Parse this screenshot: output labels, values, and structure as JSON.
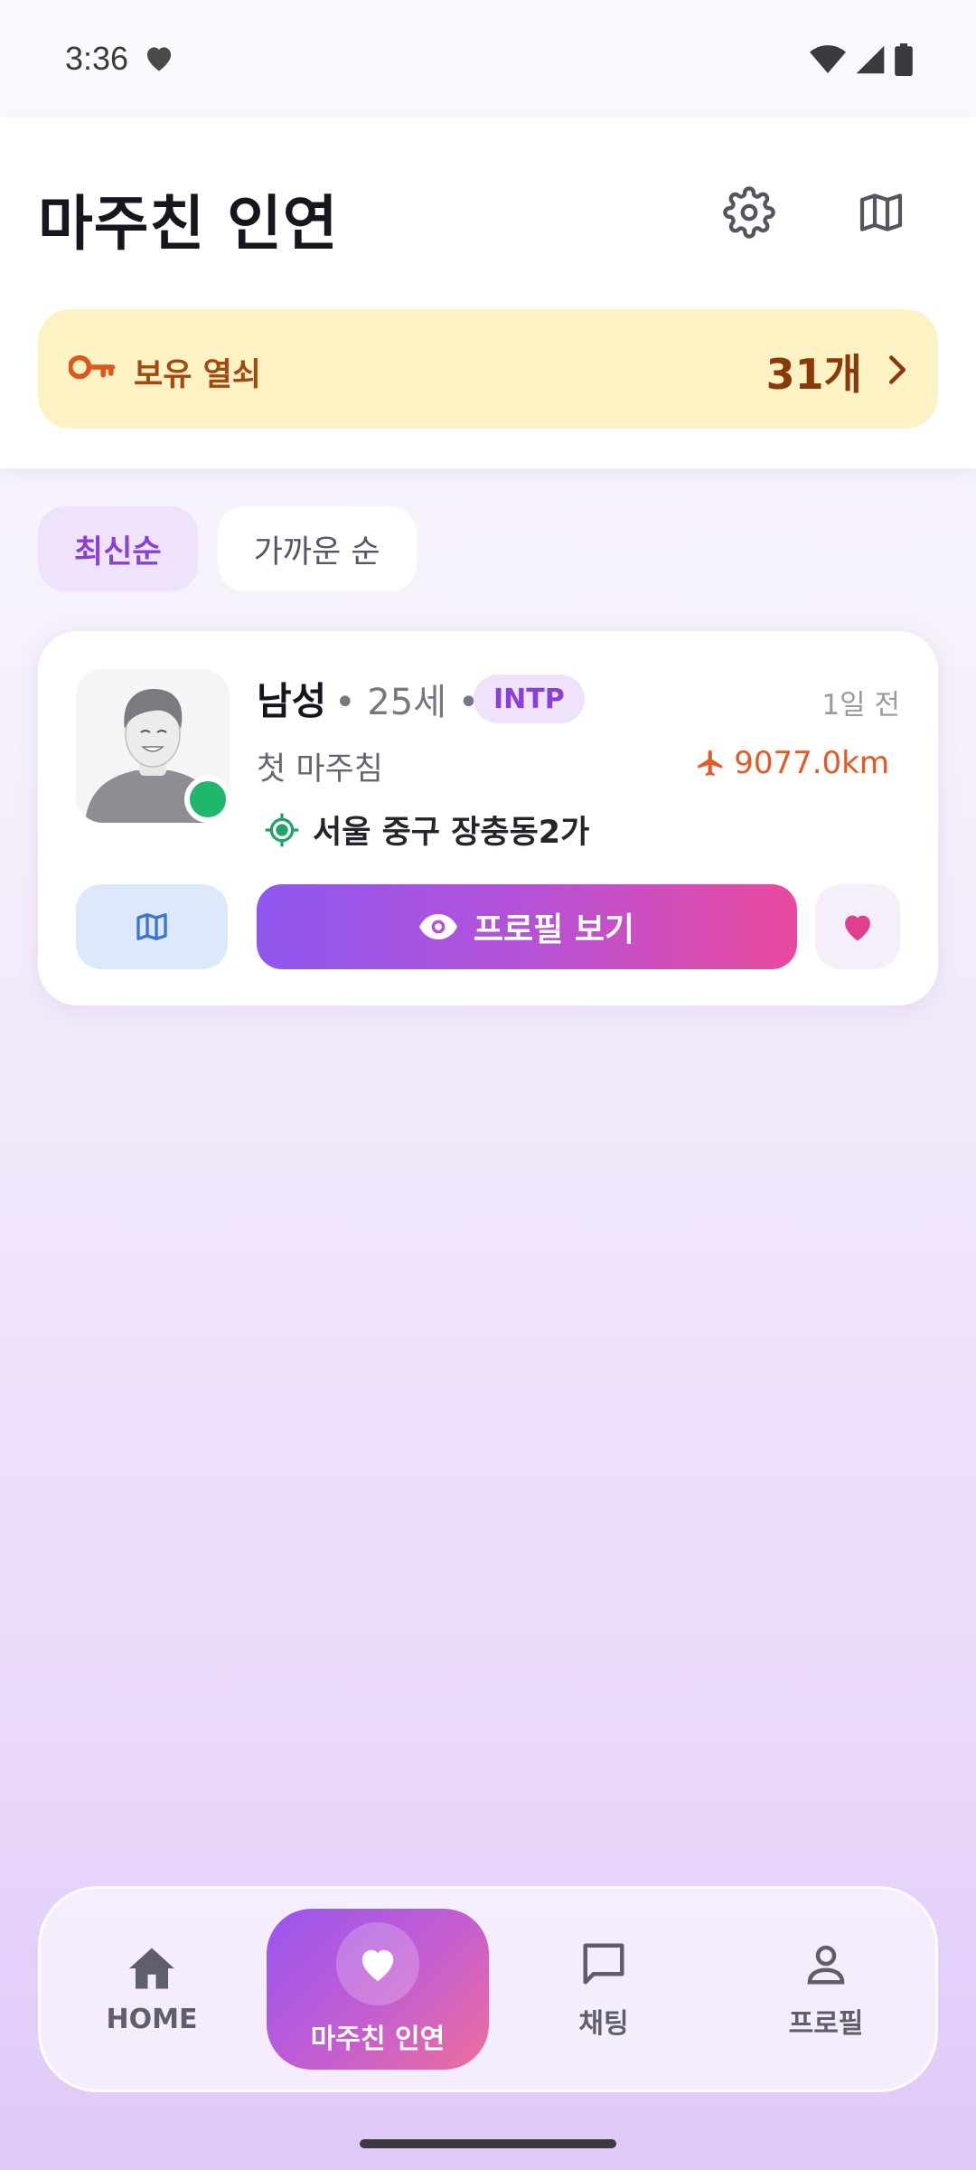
{
  "status": {
    "time": "3:36"
  },
  "header": {
    "title": "마주친 인연",
    "keys_label": "보유 열쇠",
    "keys_count": "31개"
  },
  "tabs": [
    {
      "label": "최신순",
      "active": true
    },
    {
      "label": "가까운 순",
      "active": false
    }
  ],
  "card": {
    "gender": "남성",
    "age": "• 25세 •",
    "mbti": "INTP",
    "time_ago": "1일 전",
    "encounter": "첫 마주침",
    "distance": "9077.0km",
    "location": "서울 중구 장충동2가",
    "profile_button": "프로필 보기",
    "online": true
  },
  "nav": [
    {
      "label": "HOME",
      "icon": "home-icon",
      "active": false
    },
    {
      "label": "마주친 인연",
      "icon": "heart-icon",
      "active": true
    },
    {
      "label": "채팅",
      "icon": "chat-icon",
      "active": false
    },
    {
      "label": "프로필",
      "icon": "person-icon",
      "active": false
    }
  ],
  "colors": {
    "accent_purple": "#8a3fd9",
    "keys_bg": "#fdf2c3",
    "keys_text": "#a3480f",
    "distance": "#e25a2a",
    "online": "#1fb86a",
    "heart": "#e0408d"
  }
}
